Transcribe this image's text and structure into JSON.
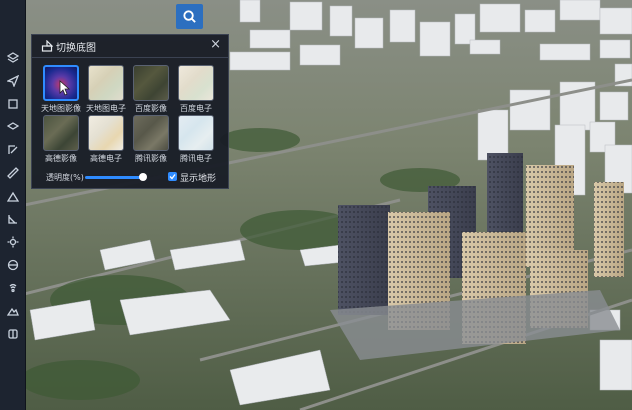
{
  "panel": {
    "title": "切换底图",
    "close_symbol": "×",
    "tiles": [
      {
        "label": "天地图影像",
        "selected": true
      },
      {
        "label": "天地图电子",
        "selected": false
      },
      {
        "label": "百度影像",
        "selected": false
      },
      {
        "label": "百度电子",
        "selected": false
      },
      {
        "label": "高德影像",
        "selected": false
      },
      {
        "label": "高德电子",
        "selected": false
      },
      {
        "label": "腾讯影像",
        "selected": false
      },
      {
        "label": "腾讯电子",
        "selected": false
      }
    ],
    "opacity_label": "透明度(%)",
    "opacity_value": 0.97,
    "terrain_label": "显示地形",
    "terrain_checked": true
  },
  "toolbar": {
    "icons": [
      "layers-icon",
      "send-icon",
      "square-icon",
      "stack-icon",
      "edit-icon",
      "ruler-icon",
      "chart-icon",
      "measure-icon",
      "settings-icon",
      "globe-icon",
      "signal-icon",
      "mountain-icon",
      "compare-icon"
    ]
  },
  "colors": {
    "accent": "#2f8cff",
    "panel_bg": "#181c26",
    "toolbar_bg": "#1d2430"
  }
}
